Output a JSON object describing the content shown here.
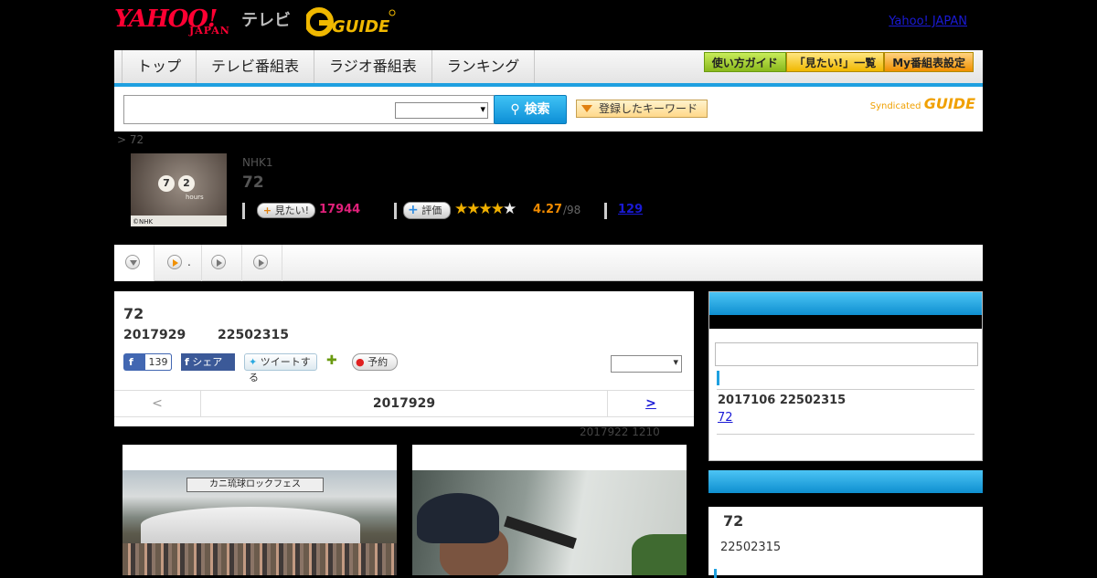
{
  "header": {
    "logo_yahoo": "YAHOO!",
    "logo_japan": "JAPAN",
    "logo_tv": "テレビ",
    "logo_gguide": "GUIDE",
    "yahoo_link": "Yahoo! JAPAN"
  },
  "nav": {
    "tabs": [
      "トップ",
      "テレビ番組表",
      "ラジオ番組表",
      "ランキング"
    ],
    "buttons": [
      "使い方ガイド",
      "「見たい!」一覧",
      "My番組表設定"
    ]
  },
  "search": {
    "button_label": "検索",
    "keyword_button": "登録したキーワード",
    "syndicated": "Syndicated",
    "syndicated_logo": "GUIDE"
  },
  "program": {
    "breadcrumb": "> 72",
    "thumb_numbers": [
      "7",
      "2"
    ],
    "thumb_hours": "hours",
    "thumb_credit": "©NHK",
    "channel": "NHK1",
    "title": "72",
    "mitai_label": "見たい!",
    "mitai_count": "17944",
    "hyoka_label": "評価",
    "stars_filled": 4,
    "rating": "4.27",
    "rating_count": "/98",
    "comments": "129"
  },
  "subtabs": {
    "tab2_label": "."
  },
  "main": {
    "title": "72",
    "date": "2017929",
    "time": "22502315",
    "fb_like": "139",
    "fb_share": "シェア",
    "tweet": "ツイートする",
    "reserve": "予約",
    "pager_prev": "<",
    "pager_date": "2017929",
    "pager_next": ">",
    "updated": "2017922  1210",
    "photo1_banner": "カニ琉球ロックフェス"
  },
  "sidebar": {
    "box1_date": "2017106  22502315",
    "box1_link": "72",
    "box2_title": "72",
    "box2_time": "22502315"
  },
  "colors": {
    "accent_blue": "#1ea0e0",
    "yahoo_red": "#ff0033",
    "gguide_yellow": "#f0b800",
    "mitai_pink": "#e0207a",
    "rating_orange": "#f08a00",
    "link_blue": "#1a1ad6"
  }
}
